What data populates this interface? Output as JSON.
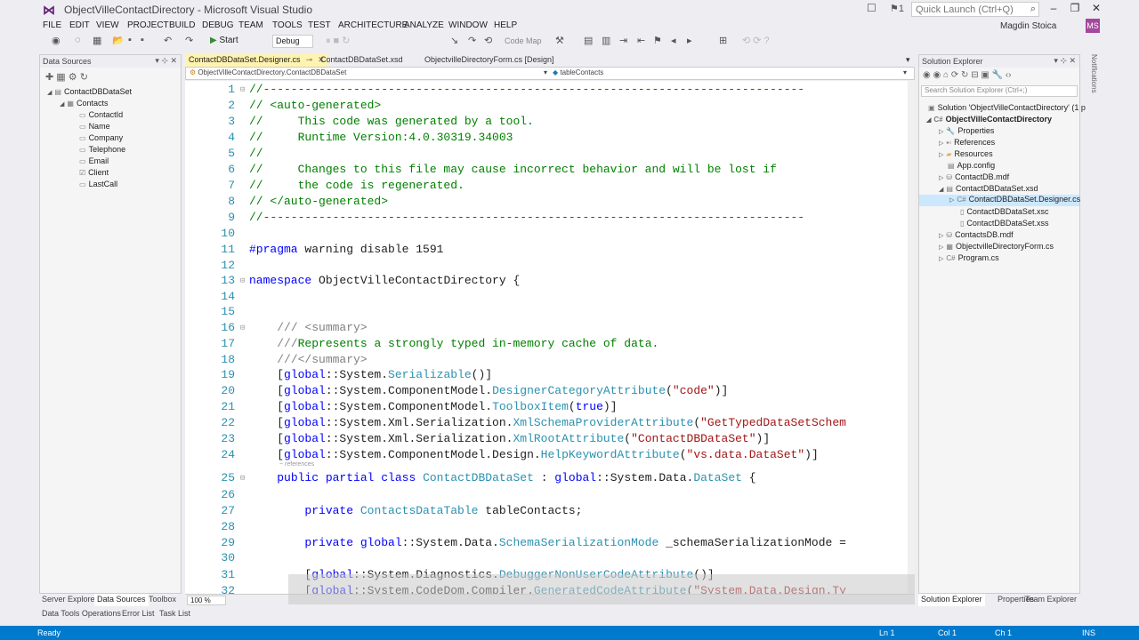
{
  "window": {
    "title": "ObjectVilleContactDirectory - Microsoft Visual Studio",
    "quick_launch_placeholder": "Quick Launch (Ctrl+Q)",
    "notification_count": "1",
    "user": "Magdin Stoica",
    "user_initials": "MS"
  },
  "menu": [
    "FILE",
    "EDIT",
    "VIEW",
    "PROJECT",
    "BUILD",
    "DEBUG",
    "TEAM",
    "TOOLS",
    "TEST",
    "ARCHITECTURE",
    "ANALYZE",
    "WINDOW",
    "HELP"
  ],
  "toolbar": {
    "start_label": "Start",
    "configuration": "Debug",
    "code_map_label": "Code Map"
  },
  "data_sources": {
    "title": "Data Sources",
    "tree": [
      {
        "label": "ContactDBDataSet",
        "level": 0,
        "expanded": true,
        "icon": "dataset-icon"
      },
      {
        "label": "Contacts",
        "level": 1,
        "expanded": true,
        "icon": "table-icon"
      },
      {
        "label": "ContactId",
        "level": 2,
        "icon": "field-icon"
      },
      {
        "label": "Name",
        "level": 2,
        "icon": "field-icon"
      },
      {
        "label": "Company",
        "level": 2,
        "icon": "field-icon"
      },
      {
        "label": "Telephone",
        "level": 2,
        "icon": "field-icon"
      },
      {
        "label": "Email",
        "level": 2,
        "icon": "field-icon"
      },
      {
        "label": "Client",
        "level": 2,
        "icon": "checkbox-field-icon"
      },
      {
        "label": "LastCall",
        "level": 2,
        "icon": "field-icon"
      }
    ],
    "bottom_tabs": [
      "Server Explorer",
      "Data Sources",
      "Toolbox"
    ],
    "active_tab": "Data Sources"
  },
  "editor": {
    "tabs": [
      {
        "label": "ContactDBDataSet.Designer.cs",
        "active": true
      },
      {
        "label": "ContactDBDataSet.xsd",
        "active": false
      },
      {
        "label": "ObjectvilleDirectoryForm.cs [Design]",
        "active": false
      }
    ],
    "nav_left": "ObjectVilleContactDirectory.ContactDBDataSet",
    "nav_right": "tableContacts",
    "zoom": "100 %",
    "references_hint": "~ references",
    "lines": [
      {
        "n": "1",
        "fold": "⊟",
        "segs": [
          {
            "c": "cm",
            "t": "//------------------------------------------------------------------------------"
          }
        ]
      },
      {
        "n": "2",
        "segs": [
          {
            "c": "cm",
            "t": "// <auto-generated>"
          }
        ]
      },
      {
        "n": "3",
        "segs": [
          {
            "c": "cm",
            "t": "//     This code was generated by a tool."
          }
        ]
      },
      {
        "n": "4",
        "segs": [
          {
            "c": "cm",
            "t": "//     Runtime Version:4.0.30319.34003"
          }
        ]
      },
      {
        "n": "5",
        "segs": [
          {
            "c": "cm",
            "t": "//"
          }
        ]
      },
      {
        "n": "6",
        "segs": [
          {
            "c": "cm",
            "t": "//     Changes to this file may cause incorrect behavior and will be lost if"
          }
        ]
      },
      {
        "n": "7",
        "segs": [
          {
            "c": "cm",
            "t": "//     the code is regenerated."
          }
        ]
      },
      {
        "n": "8",
        "segs": [
          {
            "c": "cm",
            "t": "// </auto-generated>"
          }
        ]
      },
      {
        "n": "9",
        "segs": [
          {
            "c": "cm",
            "t": "//------------------------------------------------------------------------------"
          }
        ]
      },
      {
        "n": "10",
        "segs": []
      },
      {
        "n": "11",
        "segs": [
          {
            "c": "pp",
            "t": "#pragma"
          },
          {
            "c": "",
            "t": " warning disable 1591"
          }
        ]
      },
      {
        "n": "12",
        "segs": []
      },
      {
        "n": "13",
        "fold": "⊟",
        "segs": [
          {
            "c": "kw",
            "t": "namespace"
          },
          {
            "c": "",
            "t": " ObjectVilleContactDirectory {"
          }
        ]
      },
      {
        "n": "14",
        "segs": []
      },
      {
        "n": "15",
        "segs": []
      },
      {
        "n": "16",
        "fold": "⊟",
        "segs": [
          {
            "c": "",
            "t": "    "
          },
          {
            "c": "gy",
            "t": "/// <summary>"
          }
        ]
      },
      {
        "n": "17",
        "segs": [
          {
            "c": "",
            "t": "    "
          },
          {
            "c": "gy",
            "t": "///"
          },
          {
            "c": "cm",
            "t": "Represents a strongly typed in-memory cache of data."
          }
        ]
      },
      {
        "n": "18",
        "segs": [
          {
            "c": "",
            "t": "    "
          },
          {
            "c": "gy",
            "t": "///</summary>"
          }
        ]
      },
      {
        "n": "19",
        "segs": [
          {
            "c": "",
            "t": "    ["
          },
          {
            "c": "kw",
            "t": "global"
          },
          {
            "c": "",
            "t": "::System."
          },
          {
            "c": "ty",
            "t": "Serializable"
          },
          {
            "c": "",
            "t": "()]"
          }
        ]
      },
      {
        "n": "20",
        "segs": [
          {
            "c": "",
            "t": "    ["
          },
          {
            "c": "kw",
            "t": "global"
          },
          {
            "c": "",
            "t": "::System.ComponentModel."
          },
          {
            "c": "ty",
            "t": "DesignerCategoryAttribute"
          },
          {
            "c": "",
            "t": "("
          },
          {
            "c": "st",
            "t": "\"code\""
          },
          {
            "c": "",
            "t": ")]"
          }
        ]
      },
      {
        "n": "21",
        "segs": [
          {
            "c": "",
            "t": "    ["
          },
          {
            "c": "kw",
            "t": "global"
          },
          {
            "c": "",
            "t": "::System.ComponentModel."
          },
          {
            "c": "ty",
            "t": "ToolboxItem"
          },
          {
            "c": "",
            "t": "("
          },
          {
            "c": "kw",
            "t": "true"
          },
          {
            "c": "",
            "t": ")]"
          }
        ]
      },
      {
        "n": "22",
        "segs": [
          {
            "c": "",
            "t": "    ["
          },
          {
            "c": "kw",
            "t": "global"
          },
          {
            "c": "",
            "t": "::System.Xml.Serialization."
          },
          {
            "c": "ty",
            "t": "XmlSchemaProviderAttribute"
          },
          {
            "c": "",
            "t": "("
          },
          {
            "c": "st",
            "t": "\"GetTypedDataSetSchem"
          }
        ]
      },
      {
        "n": "23",
        "segs": [
          {
            "c": "",
            "t": "    ["
          },
          {
            "c": "kw",
            "t": "global"
          },
          {
            "c": "",
            "t": "::System.Xml.Serialization."
          },
          {
            "c": "ty",
            "t": "XmlRootAttribute"
          },
          {
            "c": "",
            "t": "("
          },
          {
            "c": "st",
            "t": "\"ContactDBDataSet\""
          },
          {
            "c": "",
            "t": ")]"
          }
        ]
      },
      {
        "n": "24",
        "segs": [
          {
            "c": "",
            "t": "    ["
          },
          {
            "c": "kw",
            "t": "global"
          },
          {
            "c": "",
            "t": "::System.ComponentModel.Design."
          },
          {
            "c": "ty",
            "t": "HelpKeywordAttribute"
          },
          {
            "c": "",
            "t": "("
          },
          {
            "c": "st",
            "t": "\"vs.data.DataSet\""
          },
          {
            "c": "",
            "t": ")]"
          }
        ]
      },
      {
        "n": "25",
        "fold": "⊟",
        "segs": [
          {
            "c": "",
            "t": "    "
          },
          {
            "c": "kw",
            "t": "public partial class"
          },
          {
            "c": "",
            "t": " "
          },
          {
            "c": "ty",
            "t": "ContactDBDataSet"
          },
          {
            "c": "",
            "t": " : "
          },
          {
            "c": "kw",
            "t": "global"
          },
          {
            "c": "",
            "t": "::System.Data."
          },
          {
            "c": "ty",
            "t": "DataSet"
          },
          {
            "c": "",
            "t": " {"
          }
        ]
      },
      {
        "n": "26",
        "segs": []
      },
      {
        "n": "27",
        "segs": [
          {
            "c": "",
            "t": "        "
          },
          {
            "c": "kw",
            "t": "private"
          },
          {
            "c": "",
            "t": " "
          },
          {
            "c": "ty",
            "t": "ContactsDataTable"
          },
          {
            "c": "",
            "t": " tableContacts;"
          }
        ]
      },
      {
        "n": "28",
        "segs": []
      },
      {
        "n": "29",
        "segs": [
          {
            "c": "",
            "t": "        "
          },
          {
            "c": "kw",
            "t": "private global"
          },
          {
            "c": "",
            "t": "::System.Data."
          },
          {
            "c": "ty",
            "t": "SchemaSerializationMode"
          },
          {
            "c": "",
            "t": " _schemaSerializationMode ="
          }
        ]
      },
      {
        "n": "30",
        "segs": []
      },
      {
        "n": "31",
        "segs": [
          {
            "c": "",
            "t": "        ["
          },
          {
            "c": "kw",
            "t": "global"
          },
          {
            "c": "",
            "t": "::System.Diagnostics."
          },
          {
            "c": "ty",
            "t": "DebuggerNonUserCodeAttribute"
          },
          {
            "c": "",
            "t": "()]"
          }
        ]
      },
      {
        "n": "32",
        "segs": [
          {
            "c": "",
            "t": "        ["
          },
          {
            "c": "kw",
            "t": "global"
          },
          {
            "c": "",
            "t": "::System.CodeDom.Compiler."
          },
          {
            "c": "ty",
            "t": "GeneratedCodeAttribute"
          },
          {
            "c": "",
            "t": "("
          },
          {
            "c": "st",
            "t": "\"System.Data.Design.Ty"
          }
        ]
      }
    ]
  },
  "solution_explorer": {
    "title": "Solution Explorer",
    "search_placeholder": "Search Solution Explorer (Ctrl+;)",
    "tree": [
      {
        "label": "Solution 'ObjectVilleContactDirectory' (1 p",
        "level": 0,
        "icon": "solution-icon"
      },
      {
        "label": "ObjectVilleContactDirectory",
        "level": 0,
        "expanded": true,
        "bold": true,
        "icon": "csharp-project-icon"
      },
      {
        "label": "Properties",
        "level": 1,
        "collapsed": true,
        "icon": "wrench-icon"
      },
      {
        "label": "References",
        "level": 1,
        "collapsed": true,
        "icon": "references-icon"
      },
      {
        "label": "Resources",
        "level": 1,
        "collapsed": true,
        "icon": "folder-icon"
      },
      {
        "label": "App.config",
        "level": 1,
        "icon": "config-icon"
      },
      {
        "label": "ContactDB.mdf",
        "level": 1,
        "collapsed": true,
        "icon": "database-icon"
      },
      {
        "label": "ContactDBDataSet.xsd",
        "level": 1,
        "expanded": true,
        "icon": "dataset-icon"
      },
      {
        "label": "ContactDBDataSet.Designer.cs",
        "level": 2,
        "collapsed": true,
        "selected": true,
        "icon": "csharp-file-icon"
      },
      {
        "label": "ContactDBDataSet.xsc",
        "level": 2,
        "icon": "file-icon"
      },
      {
        "label": "ContactDBDataSet.xss",
        "level": 2,
        "icon": "file-icon"
      },
      {
        "label": "ContactsDB.mdf",
        "level": 1,
        "collapsed": true,
        "icon": "database-icon"
      },
      {
        "label": "ObjectvilleDirectoryForm.cs",
        "level": 1,
        "collapsed": true,
        "icon": "form-icon"
      },
      {
        "label": "Program.cs",
        "level": 1,
        "collapsed": true,
        "icon": "csharp-file-icon"
      }
    ],
    "bottom_tabs": [
      "Solution Explorer",
      "Properties",
      "Team Explorer"
    ],
    "active_tab": "Solution Explorer"
  },
  "notifications_label": "Notifications",
  "bottom_tool_tabs": [
    "Data Tools Operations",
    "Error List",
    "Task List"
  ],
  "status": {
    "left": "Ready",
    "ln": "Ln 1",
    "col": "Col 1",
    "ch": "Ch 1",
    "mode": "INS"
  },
  "colors": {
    "status_bar": "#007acc",
    "active_tab": "#fff3b0",
    "comment": "#008000",
    "keyword": "#0000ff",
    "type": "#2b91af",
    "string": "#a31515"
  }
}
